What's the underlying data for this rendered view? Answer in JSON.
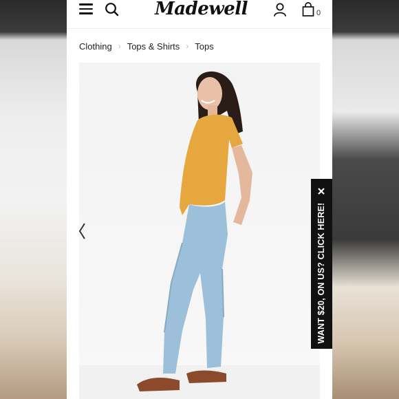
{
  "header": {
    "logo": "Madewell",
    "bag_count": "0"
  },
  "breadcrumb": [
    "Clothing",
    "Tops & Shirts",
    "Tops"
  ],
  "promo": {
    "text": "WANT $20, ON US? CLICK HERE!"
  },
  "icons": [
    "menu-icon",
    "search-icon",
    "account-icon",
    "bag-icon",
    "close-icon",
    "chevron-left-icon"
  ],
  "colors": {
    "text": "#111111",
    "promo_bg": "#111111",
    "top": "#e7a73f",
    "jeans": "#9cc0d9"
  }
}
